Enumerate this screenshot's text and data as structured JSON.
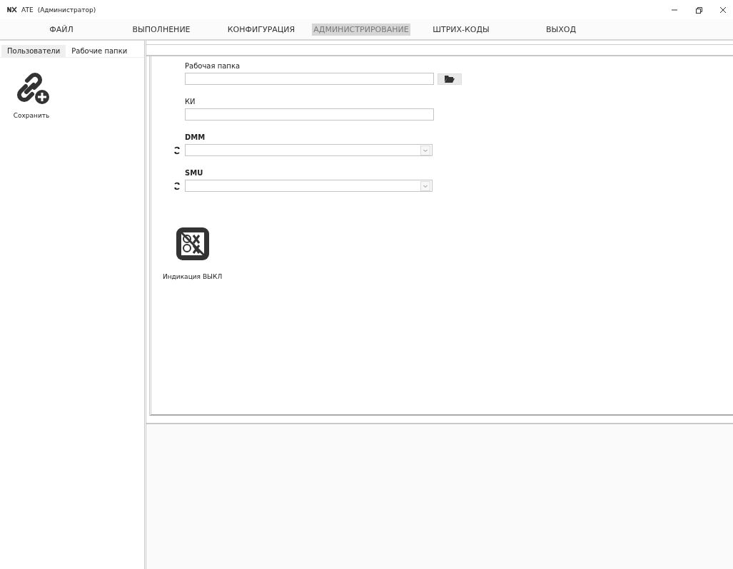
{
  "window": {
    "app": "ATE",
    "role": "(Администратор)"
  },
  "menu": [
    {
      "label": "ФАЙЛ",
      "selected": false
    },
    {
      "label": "ВЫПОЛНЕНИЕ",
      "selected": false
    },
    {
      "label": "КОНФИГУРАЦИЯ",
      "selected": false
    },
    {
      "label": "АДМИНИСТРИРОВАНИЕ",
      "selected": true
    },
    {
      "label": "ШТРИХ-КОДЫ",
      "selected": false
    },
    {
      "label": "ВЫХОД",
      "selected": false
    }
  ],
  "tabs": [
    {
      "label": "Пользователи",
      "selected": false
    },
    {
      "label": "Рабочие папки",
      "selected": true
    }
  ],
  "sidebar": {
    "save_label": "Сохранить"
  },
  "form": [
    {
      "kind": "folder",
      "label": "Рабочая папка"
    },
    {
      "kind": "text",
      "label": "КИ"
    },
    {
      "kind": "select",
      "label": "DMM"
    },
    {
      "kind": "select",
      "label": "SMU"
    }
  ],
  "indication": {
    "label": "Индикация ВЫКЛ"
  }
}
